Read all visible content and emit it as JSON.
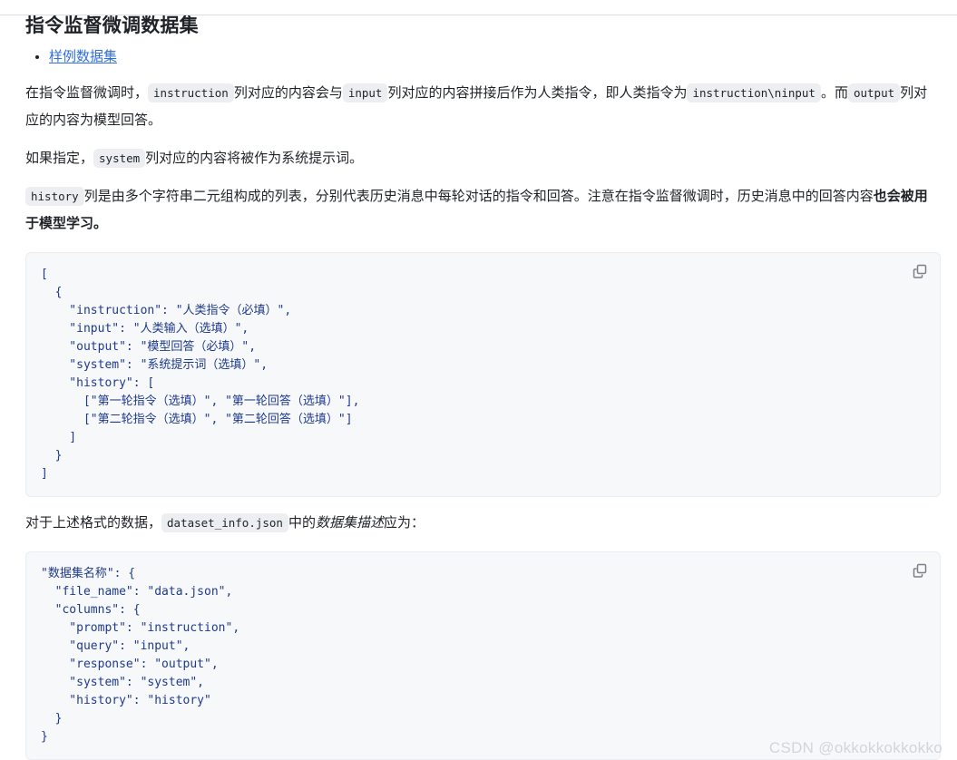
{
  "page": {
    "title": "指令监督微调数据集"
  },
  "links": {
    "sample_dataset": "样例数据集"
  },
  "paragraphs": {
    "p1": {
      "seg1": "在指令监督微调时，",
      "code1": "instruction",
      "seg2": "列对应的内容会与",
      "code2": "input",
      "seg3": "列对应的内容拼接后作为人类指令，即人类指令为",
      "code3": "instruction\\ninput",
      "seg4": "。而",
      "code4": "output",
      "seg5": "列对应的内容为模型回答。"
    },
    "p2": {
      "seg1": "如果指定，",
      "code1": "system",
      "seg2": "列对应的内容将被作为系统提示词。"
    },
    "p3": {
      "code1": "history",
      "seg1": "列是由多个字符串二元组构成的列表，分别代表历史消息中每轮对话的指令和回答。注意在指令监督微调时，历史消息中的回答内容",
      "bold1": "也会被用于模型学习。"
    },
    "p4": {
      "seg1": "对于上述格式的数据，",
      "code1": "dataset_info.json",
      "seg2": "中的",
      "italic1": "数据集描述",
      "seg3": "应为："
    }
  },
  "code_blocks": [
    {
      "name": "sft-dataset-example",
      "copy_label": "copy-icon",
      "content": "[\n  {\n    \"instruction\": \"人类指令（必填）\",\n    \"input\": \"人类输入（选填）\",\n    \"output\": \"模型回答（必填）\",\n    \"system\": \"系统提示词（选填）\",\n    \"history\": [\n      [\"第一轮指令（选填）\", \"第一轮回答（选填）\"],\n      [\"第二轮指令（选填）\", \"第二轮回答（选填）\"]\n    ]\n  }\n]"
    },
    {
      "name": "dataset-info-example",
      "copy_label": "copy-icon",
      "content": "\"数据集名称\": {\n  \"file_name\": \"data.json\",\n  \"columns\": {\n    \"prompt\": \"instruction\",\n    \"query\": \"input\",\n    \"response\": \"output\",\n    \"system\": \"system\",\n    \"history\": \"history\"\n  }\n}"
    }
  ],
  "watermark": {
    "text": "CSDN @okkokkokkokko"
  },
  "colors": {
    "link": "#2f6fdd",
    "code_text": "#1f3a8a",
    "code_bg": "#f6f8fa",
    "inline_code_bg": "#eceef1",
    "body_text": "#1f2328",
    "watermark": "#d2d5d9"
  }
}
